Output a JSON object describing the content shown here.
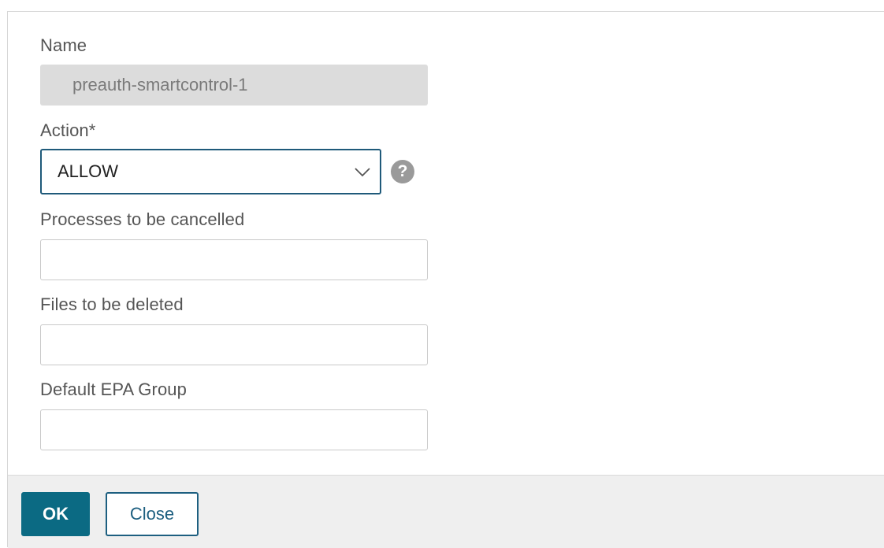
{
  "form": {
    "name_label": "Name",
    "name_value": "preauth-smartcontrol-1",
    "action_label": "Action*",
    "action_selected": "ALLOW",
    "processes_label": "Processes to be cancelled",
    "processes_value": "",
    "files_label": "Files to be deleted",
    "files_value": "",
    "epa_group_label": "Default EPA Group",
    "epa_group_value": "",
    "help_glyph": "?"
  },
  "footer": {
    "ok_label": "OK",
    "close_label": "Close"
  },
  "colors": {
    "primary_button": "#0b6a83",
    "select_border": "#1f5a7a",
    "readonly_field": "#dcdcdc",
    "footer_bg": "#efefef"
  }
}
